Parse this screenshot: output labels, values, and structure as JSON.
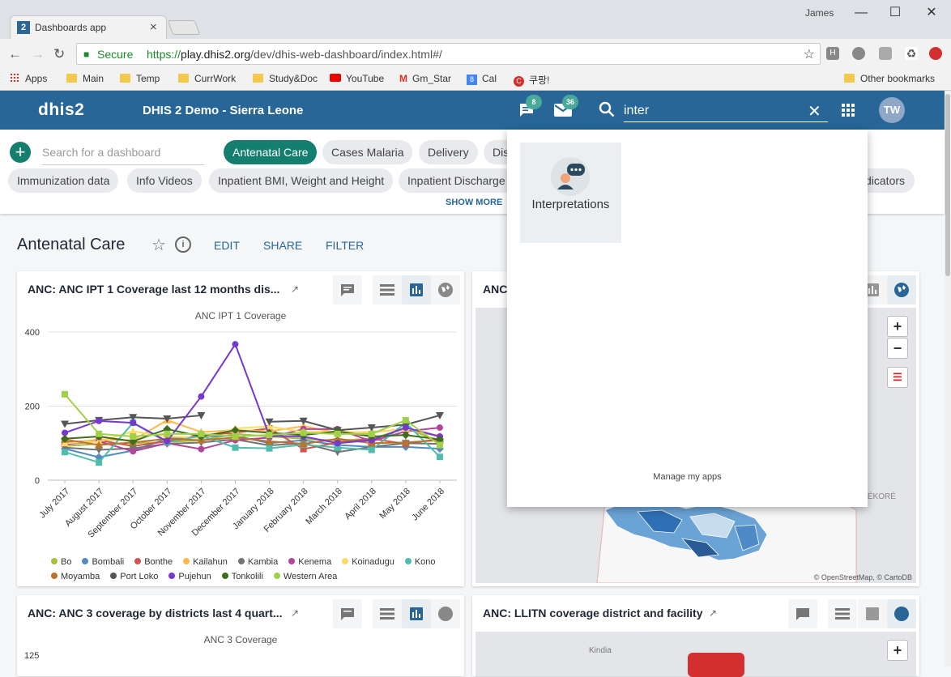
{
  "browser": {
    "tab_title": "Dashboards app",
    "tab_icon_text": "2",
    "user": "James",
    "secure_label": "Secure",
    "url_scheme": "https://",
    "url_host": "play.dhis2.org",
    "url_path": "/dev/dhis-web-dashboard/index.html#/",
    "bookmarks": [
      "Apps",
      "Main",
      "Temp",
      "CurrWork",
      "Study&Doc",
      "YouTube",
      "Gm_Star",
      "Cal",
      "쿠팡!"
    ],
    "other_bookmarks": "Other bookmarks"
  },
  "header": {
    "logo": "dhis2",
    "title": "DHIS 2 Demo - Sierra Leone",
    "interpretations_count": "8",
    "messages_count": "36",
    "search_value": "inter",
    "avatar": "TW"
  },
  "dashbar": {
    "search_placeholder": "Search for a dashboard",
    "chips_row1": [
      "Antenatal Care",
      "Cases Malaria",
      "Delivery",
      "Dis"
    ],
    "chips_row2": [
      "Immunization data",
      "Info Videos",
      "Inpatient BMI, Weight and Height",
      "Inpatient Discharge"
    ],
    "chip_right": "dicators",
    "show_more": "SHOW MORE"
  },
  "dashboard": {
    "title": "Antenatal Care",
    "info": "i",
    "actions": {
      "edit": "EDIT",
      "share": "SHARE",
      "filter": "FILTER"
    }
  },
  "items": [
    {
      "title": "ANC: ANC IPT 1 Coverage last 12 months dis...",
      "subtitle": "ANC IPT 1 Coverage"
    },
    {
      "title": "ANC"
    },
    {
      "title": "ANC: ANC 3 coverage by districts last 4 quart...",
      "subtitle": "ANC 3 Coverage",
      "ytick": "125"
    },
    {
      "title": "ANC: LLITN coverage district and facility"
    }
  ],
  "map": {
    "attribution": "© OpenStreetMap, © CartoDB",
    "label_kerekore": "ÉRÉKORÉ",
    "label_kindia": "Kindia"
  },
  "popup": {
    "app_name": "Interpretations",
    "manage": "Manage my apps"
  },
  "chart_data": {
    "type": "line",
    "title": "ANC IPT 1 Coverage",
    "ylim": [
      0,
      400
    ],
    "yticks": [
      "0",
      "200",
      "400"
    ],
    "categories": [
      "July 2017",
      "August 2017",
      "September 2017",
      "October 2017",
      "November 2017",
      "December 2017",
      "January 2018",
      "February 2018",
      "March 2018",
      "April 2018",
      "May 2018",
      "June 2018"
    ],
    "series": [
      {
        "name": "Bo",
        "color": "#a9be3b",
        "values": [
          92,
          98,
          100,
          103,
          108,
          125,
          118,
          112,
          107,
          112,
          140,
          105
        ]
      },
      {
        "name": "Bombali",
        "color": "#558cc0",
        "values": [
          85,
          62,
          80,
          112,
          118,
          120,
          100,
          108,
          95,
          90,
          90,
          85
        ]
      },
      {
        "name": "Bonthe",
        "color": "#d1544f",
        "values": [
          102,
          108,
          92,
          105,
          122,
          128,
          140,
          84,
          102,
          112,
          98,
          112
        ]
      },
      {
        "name": "Kailahun",
        "color": "#ffb94a",
        "values": [
          98,
          110,
          108,
          162,
          130,
          135,
          132,
          146,
          128,
          130,
          138,
          118
        ]
      },
      {
        "name": "Kambia",
        "color": "#737373",
        "values": [
          88,
          82,
          86,
          98,
          102,
          110,
          94,
          100,
          76,
          90,
          100,
          98
        ]
      },
      {
        "name": "Kenema",
        "color": "#b4459c",
        "values": [
          97,
          105,
          78,
          100,
          84,
          108,
          115,
          138,
          138,
          105,
          132,
          142
        ]
      },
      {
        "name": "Koinadugu",
        "color": "#ffda64",
        "values": [
          100,
          104,
          132,
          118,
          114,
          140,
          145,
          130,
          132,
          128,
          140,
          120
        ]
      },
      {
        "name": "Kono",
        "color": "#4fbdae",
        "values": [
          76,
          48,
          155,
          102,
          120,
          88,
          86,
          96,
          88,
          82,
          155,
          63
        ]
      },
      {
        "name": "Moyamba",
        "color": "#b9732d",
        "values": [
          110,
          95,
          102,
          112,
          108,
          115,
          105,
          98,
          112,
          100,
          102,
          108
        ]
      },
      {
        "name": "Port Loko",
        "color": "#555555",
        "values": [
          152,
          162,
          170,
          166,
          175,
          null,
          158,
          160,
          135,
          142,
          150,
          175
        ]
      },
      {
        "name": "Pujehun",
        "color": "#7738ce",
        "values": [
          128,
          160,
          155,
          105,
          226,
          367,
          120,
          118,
          100,
          108,
          142,
          118
        ]
      },
      {
        "name": "Tonkolili",
        "color": "#3e6d1e",
        "values": [
          112,
          118,
          105,
          138,
          118,
          135,
          128,
          122,
          132,
          118,
          122,
          110
        ]
      },
      {
        "name": "Western Area",
        "color": "#a1d04b",
        "values": [
          232,
          125,
          118,
          125,
          125,
          118,
          122,
          128,
          125,
          125,
          162,
          95
        ]
      }
    ]
  }
}
